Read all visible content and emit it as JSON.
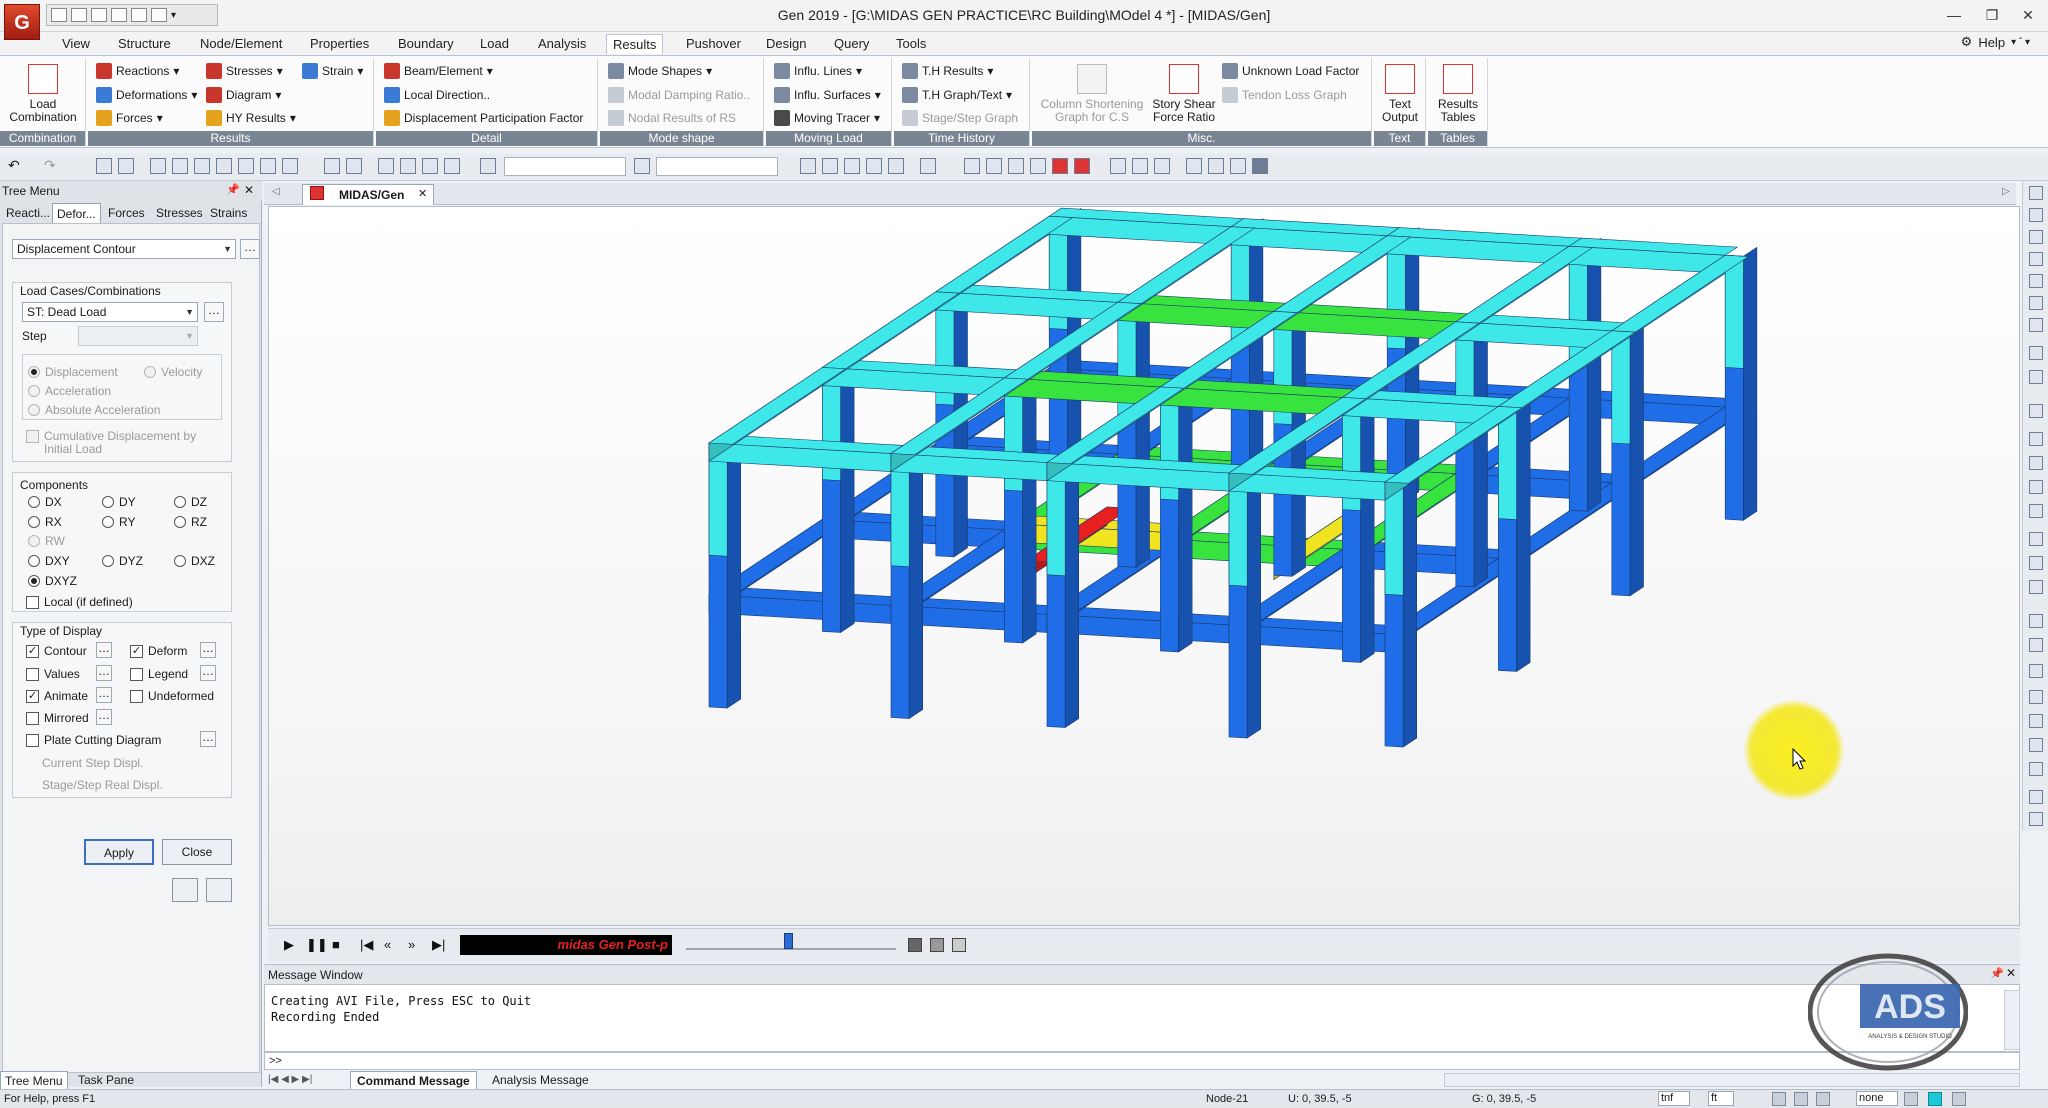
{
  "app": {
    "window_title": "Gen 2019 - [G:\\MIDAS GEN PRACTICE\\RC Building\\MOdel 4 *] - [MIDAS/Gen]",
    "logo_letter": "G"
  },
  "menu": {
    "tabs": [
      "View",
      "Structure",
      "Node/Element",
      "Properties",
      "Boundary",
      "Load",
      "Analysis",
      "Results",
      "Pushover",
      "Design",
      "Query",
      "Tools"
    ],
    "active": "Results",
    "help": "Help"
  },
  "ribbon": {
    "combination": {
      "button": "Load Combination",
      "label": "Combination"
    },
    "results": {
      "label": "Results",
      "reactions": "Reactions",
      "deformations": "Deformations",
      "forces": "Forces",
      "stresses": "Stresses",
      "diagram": "Diagram",
      "hy_results": "HY Results",
      "strain": "Strain"
    },
    "detail": {
      "label": "Detail",
      "beam_element": "Beam/Element",
      "local_direction": "Local Direction..",
      "displacement_participation": "Displacement Participation Factor"
    },
    "mode_shape": {
      "label": "Mode shape",
      "mode_shapes": "Mode Shapes",
      "modal_damping": "Modal Damping Ratio..",
      "nodal_results_rs": "Nodal Results of RS"
    },
    "moving_load": {
      "label": "Moving Load",
      "influ_lines": "Influ. Lines",
      "influ_surfaces": "Influ. Surfaces",
      "moving_tracer": "Moving Tracer"
    },
    "time_history": {
      "label": "Time History",
      "th_results": "T.H Results",
      "th_graph_text": "T.H Graph/Text",
      "stage_step_graph": "Stage/Step Graph"
    },
    "misc": {
      "label": "Misc.",
      "column_shortening": "Column Shortening Graph for C.S",
      "story_shear": "Story Shear Force Ratio",
      "unknown_load_factor": "Unknown Load Factor",
      "tendon_loss_graph": "Tendon Loss Graph"
    },
    "text": {
      "label": "Text",
      "button": "Text Output"
    },
    "tables": {
      "label": "Tables",
      "button": "Results Tables"
    }
  },
  "tree_menu": {
    "title": "Tree Menu",
    "tabs": [
      "Reacti...",
      "Defor...",
      "Forces",
      "Stresses",
      "Strains"
    ],
    "active_tab": "Defor...",
    "display_type": "Displacement Contour",
    "load_cases_label": "Load Cases/Combinations",
    "load_case_value": "ST: Dead Load",
    "step_label": "Step",
    "result_types": [
      "Displacement",
      "Velocity",
      "Acceleration",
      "Absolute Acceleration"
    ],
    "cumulative_label": "Cumulative Displacement by Initial Load",
    "components_label": "Components",
    "components": [
      "DX",
      "DY",
      "DZ",
      "RX",
      "RY",
      "RZ",
      "RW",
      "DXY",
      "DYZ",
      "DXZ",
      "DXYZ"
    ],
    "selected_component": "DXYZ",
    "local_label": "Local (if defined)",
    "type_of_display_label": "Type of Display",
    "contour": "Contour",
    "deform": "Deform",
    "values": "Values",
    "legend": "Legend",
    "animate": "Animate",
    "undeformed": "Undeformed",
    "mirrored": "Mirrored",
    "plate_cutting": "Plate Cutting Diagram",
    "current_step": "Current Step Displ.",
    "stage_step_real": "Stage/Step Real Displ.",
    "apply": "Apply",
    "close": "Close",
    "bottom_tabs": [
      "Tree Menu",
      "Task Pane"
    ]
  },
  "view": {
    "tab_label": "MIDAS/Gen",
    "colors": {
      "top_beam": "#3fe8e8",
      "column_blue": "#1f6ee8",
      "mid_green": "#39e33f",
      "hot_red": "#e81f1f",
      "yellow": "#f0e31f"
    }
  },
  "animation": {
    "banner": "midas Gen Post-p"
  },
  "message_window": {
    "title": "Message Window",
    "lines": [
      "Creating AVI File, Press ESC to Quit",
      "Recording Ended"
    ],
    "prompt": ">>",
    "tabs": [
      "Command Message",
      "Analysis Message"
    ]
  },
  "status": {
    "help": "For Help, press F1",
    "node": "Node-21",
    "u": "U: 0, 39.5, -5",
    "g": "G: 0, 39.5, -5",
    "unit_force": "tnf",
    "unit_length": "ft",
    "none": "none"
  },
  "overlay": {
    "logo_text": "ADS",
    "logo_sub": "ANALYSIS & DESIGN STUDIO"
  }
}
